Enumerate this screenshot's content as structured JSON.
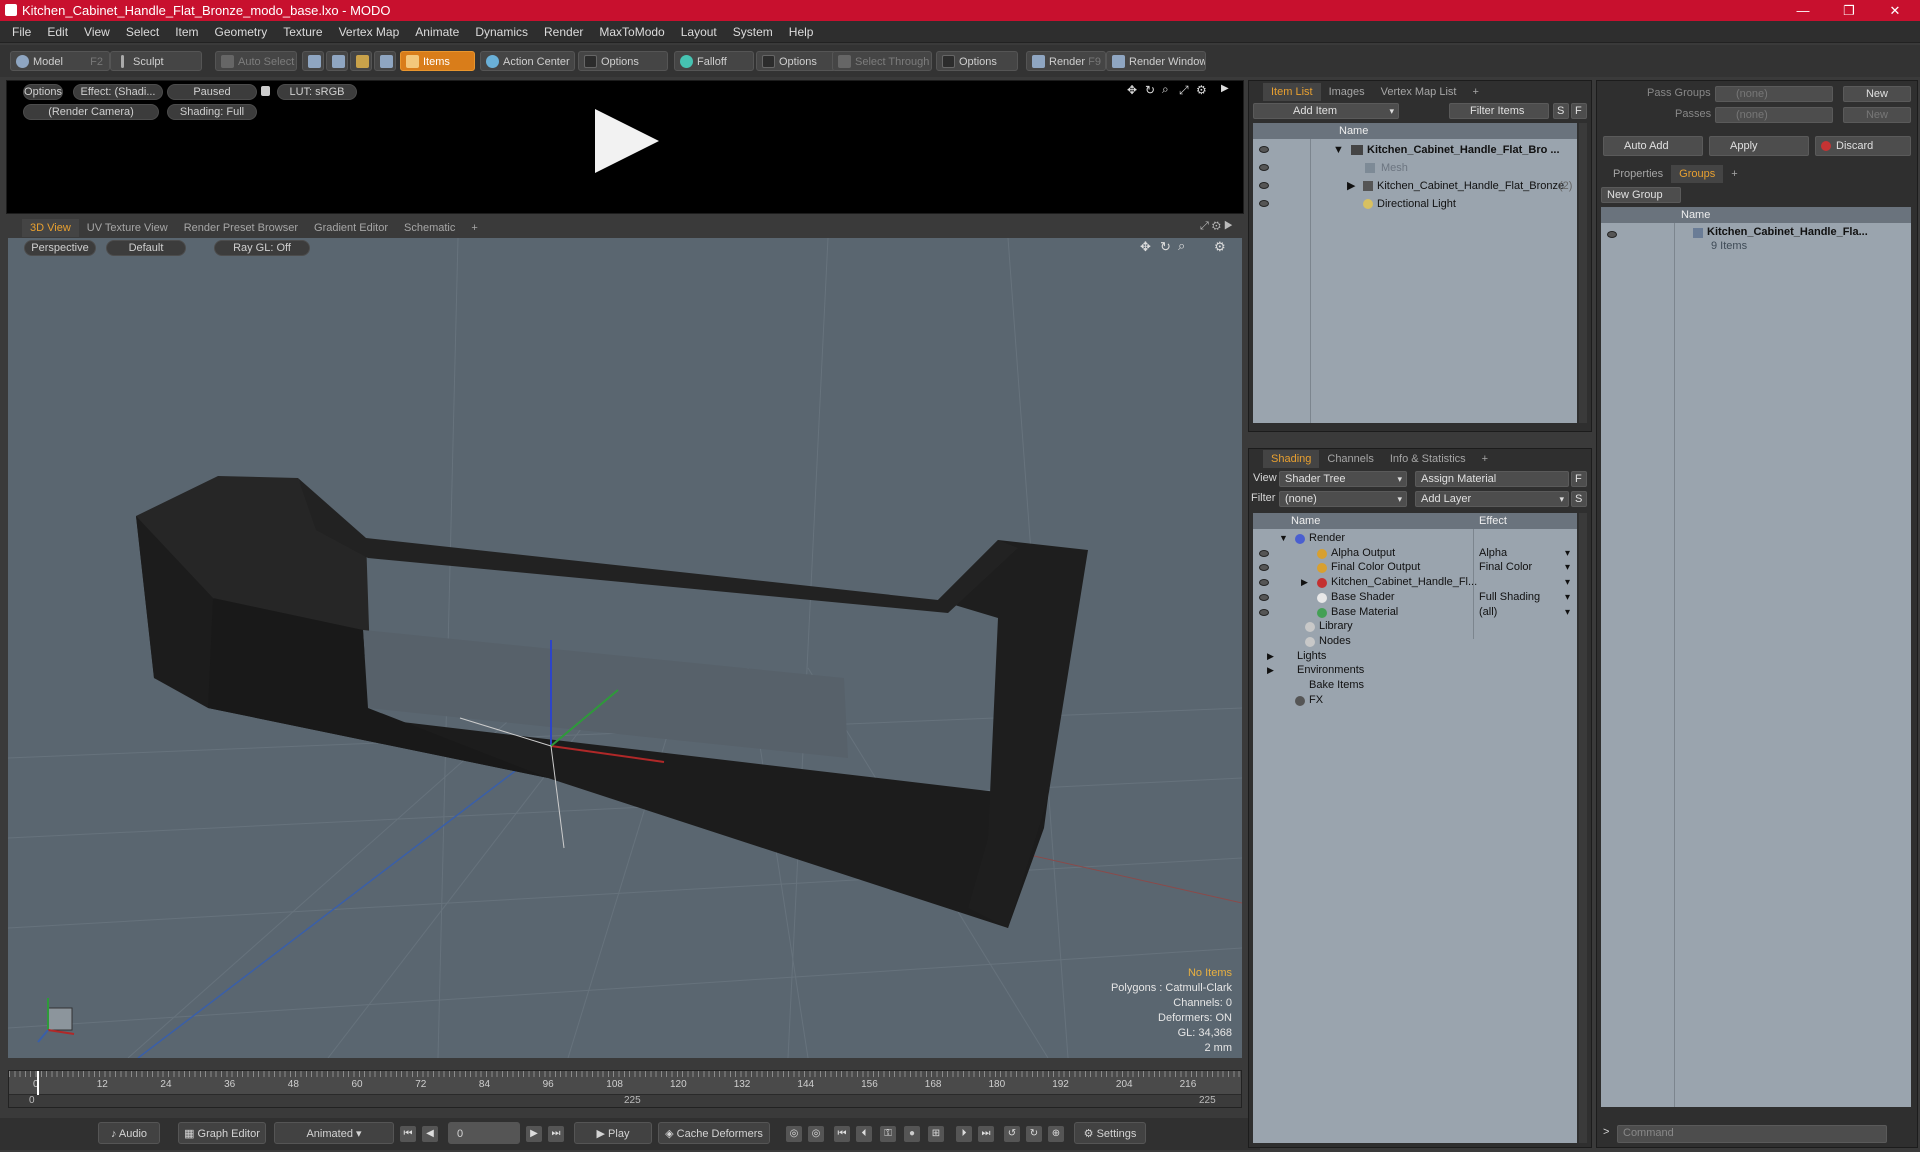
{
  "window": {
    "title": "Kitchen_Cabinet_Handle_Flat_Bronze_modo_base.lxo - MODO",
    "minimize": "—",
    "restore": "❐",
    "close": "✕"
  },
  "menu": [
    "File",
    "Edit",
    "View",
    "Select",
    "Item",
    "Geometry",
    "Texture",
    "Vertex Map",
    "Animate",
    "Dynamics",
    "Render",
    "MaxToModo",
    "Layout",
    "System",
    "Help"
  ],
  "toolbar": {
    "model": "Model",
    "model_key": "F2",
    "sculpt": "Sculpt",
    "auto_select": "Auto Select",
    "items": "Items",
    "action_center": "Action Center",
    "options1": "Options",
    "falloff": "Falloff",
    "options2": "Options",
    "select_through": "Select Through",
    "options3": "Options",
    "render": "Render",
    "render_key": "F9",
    "render_window": "Render Window"
  },
  "preview": {
    "options": "Options",
    "effect": "Effect: (Shadi...",
    "paused": "Paused",
    "lut": "LUT: sRGB",
    "camera": "(Render Camera)",
    "shading": "Shading: Full"
  },
  "view_tabs": [
    "3D View",
    "UV Texture View",
    "Render Preset Browser",
    "Gradient Editor",
    "Schematic",
    "+"
  ],
  "viewport": {
    "perspective": "Perspective",
    "default": "Default",
    "raygl": "Ray GL: Off",
    "no_items": "No Items",
    "polygons": "Polygons : Catmull-Clark",
    "channels": "Channels: 0",
    "deformers": "Deformers: ON",
    "gl": "GL: 34,368",
    "scale": "2 mm"
  },
  "timeline": {
    "ticks": [
      "0",
      "12",
      "24",
      "36",
      "48",
      "60",
      "72",
      "84",
      "96",
      "108",
      "120",
      "132",
      "144",
      "156",
      "168",
      "180",
      "192",
      "204",
      "216"
    ],
    "start": "0",
    "mid": "225",
    "end": "225"
  },
  "bottom": {
    "audio": "Audio",
    "graph_editor": "Graph Editor",
    "animated": "Animated",
    "frame": "0",
    "play": "Play",
    "cache": "Cache Deformers",
    "settings": "Settings"
  },
  "item_list": {
    "tabs": [
      "Item List",
      "Images",
      "Vertex Map List",
      "+"
    ],
    "add_item": "Add Item",
    "filter": "Filter Items",
    "s": "S",
    "f": "F",
    "col_name": "Name",
    "rows": [
      {
        "label": "Kitchen_Cabinet_Handle_Flat_Bro ..."
      },
      {
        "label": "Mesh"
      },
      {
        "label": "Kitchen_Cabinet_Handle_Flat_Bronze",
        "count": "(2)"
      },
      {
        "label": "Directional Light"
      }
    ]
  },
  "shading": {
    "tabs": [
      "Shading",
      "Channels",
      "Info & Statistics",
      "+"
    ],
    "view_label": "View",
    "view_value": "Shader Tree",
    "assign": "Assign Material",
    "f": "F",
    "filter_label": "Filter",
    "filter_value": "(none)",
    "add_layer": "Add Layer",
    "s": "S",
    "col_name": "Name",
    "col_effect": "Effect",
    "rows": [
      {
        "name": "Render",
        "effect": ""
      },
      {
        "name": "Alpha Output",
        "effect": "Alpha"
      },
      {
        "name": "Final Color Output",
        "effect": "Final Color"
      },
      {
        "name": "Kitchen_Cabinet_Handle_Fl...",
        "effect": ""
      },
      {
        "name": "Base Shader",
        "effect": "Full Shading"
      },
      {
        "name": "Base Material",
        "effect": "(all)"
      },
      {
        "name": "Library",
        "effect": ""
      },
      {
        "name": "Nodes",
        "effect": ""
      },
      {
        "name": "Lights",
        "effect": ""
      },
      {
        "name": "Environments",
        "effect": ""
      },
      {
        "name": "Bake Items",
        "effect": ""
      },
      {
        "name": "FX",
        "effect": ""
      }
    ]
  },
  "groups": {
    "pass_groups": "Pass Groups",
    "passes": "Passes",
    "none1": "(none)",
    "none2": "(none)",
    "new1": "New",
    "new2": "New",
    "auto_add": "Auto Add",
    "apply": "Apply",
    "discard": "Discard",
    "tabs": [
      "Properties",
      "Groups",
      "+"
    ],
    "new_group": "New Group",
    "col_name": "Name",
    "group_name": "Kitchen_Cabinet_Handle_Fla...",
    "group_count": "9 Items"
  },
  "command": {
    "placeholder": "Command",
    "prompt": ">"
  }
}
